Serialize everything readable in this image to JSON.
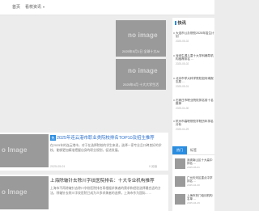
{
  "nav": {
    "home": "首页",
    "school": "看校资讯"
  },
  "feature": {
    "image1": {
      "placeholder": "no image",
      "caption": "2025年5月1日 全球十大AI"
    },
    "image2": {
      "placeholder": "no image",
      "caption": "2025年4月 十大大学生活"
    }
  },
  "articles": [
    {
      "badge": "热",
      "title": "2025年连云港市职业类院校排名TOP10及招生推荐",
      "excerpt": "在2025年的连云港市，对于在选择院校的学生来说，选择一家专业且口碑良好的学校，能够更加精准把握自身的职业规划，促进发展。",
      "date": "2025-05-01",
      "views": "0 阅读",
      "left_placeholder": "o Image"
    },
    {
      "title": "上海除皱针去除川字纹医院排名：十大专业机构推荐",
      "excerpt": "上海市不再除皱针去除川字纹医院排名再根据求美者的需求和经验选择最合适的方法，除皱针去除川字纹医院已成为众多求美者的选择，上海市作为国际……",
      "left_placeholder": "o Image"
    }
  ],
  "sidebar": {
    "heading": "快讯",
    "news": [
      {
        "text": "大连市公办院校2025年招生计划",
        "date": "2025-05-02"
      },
      {
        "text": "深圳生源儿童十大学科辅导机构推荐排名 …",
        "date": "2025-05-02"
      },
      {
        "text": "北京市学大科学院校如何填报志愿 …",
        "date": "2025-05-01"
      },
      {
        "text": "石家庄市职业院校排名前十名推荐",
        "date": "2025-04-30"
      },
      {
        "text": "杭州市高职院校学院历年排名分析",
        "date": "2025-04-29"
      }
    ],
    "tabs": {
      "hot": "热门",
      "tag": "标签"
    },
    "hot": [
      {
        "text": "深圳南山区十大高中排名 …",
        "date": "2025-05-01"
      },
      {
        "text": "广州天河区重点中学排名 …",
        "date": "2025-04-30"
      },
      {
        "text": "上海市热门培训机构名单 …",
        "date": "2025-04-29"
      }
    ]
  }
}
